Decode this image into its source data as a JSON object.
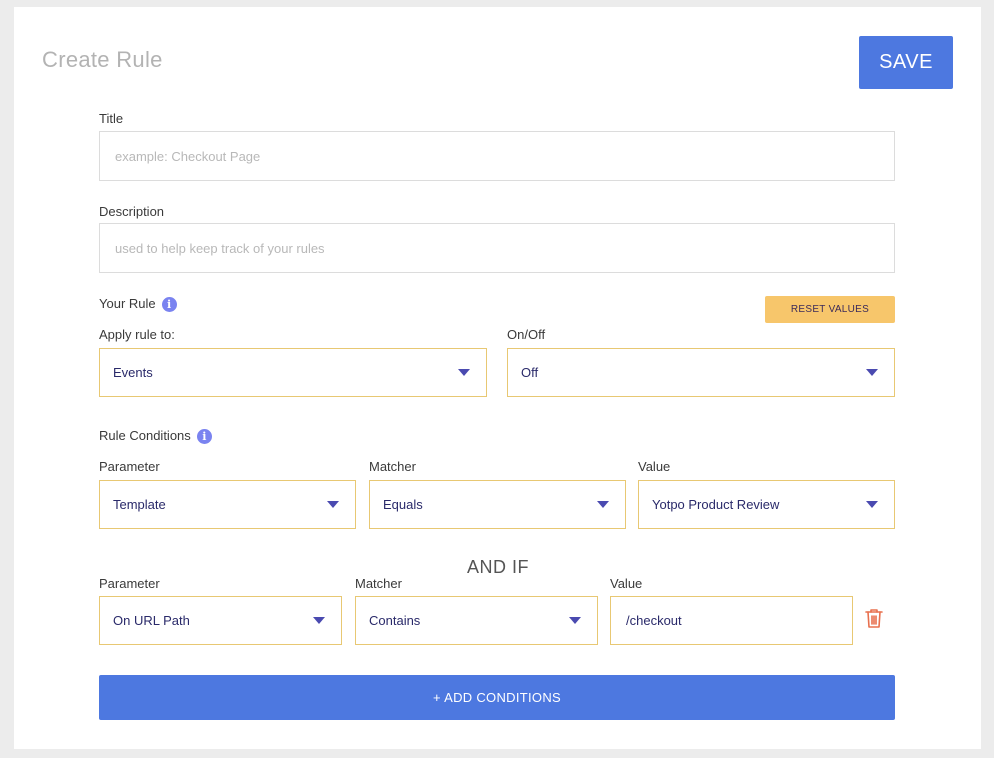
{
  "header": {
    "title": "Create Rule",
    "save_label": "SAVE"
  },
  "form": {
    "title_label": "Title",
    "title_value": "",
    "title_placeholder": "example: Checkout Page",
    "description_label": "Description",
    "description_value": "",
    "description_placeholder": "used to help keep track of your rules",
    "your_rule_label": "Your Rule",
    "reset_label": "RESET VALUES",
    "apply_rule_label": "Apply rule to:",
    "apply_rule_value": "Events",
    "onoff_label": "On/Off",
    "onoff_value": "Off"
  },
  "conditions": {
    "label": "Rule Conditions",
    "and_if_label": "AND IF",
    "rows": [
      {
        "parameter_label": "Parameter",
        "parameter_value": "Template",
        "matcher_label": "Matcher",
        "matcher_value": "Equals",
        "value_label": "Value",
        "value_value": "Yotpo Product Review"
      },
      {
        "parameter_label": "Parameter",
        "parameter_value": "On URL Path",
        "matcher_label": "Matcher",
        "matcher_value": "Contains",
        "value_label": "Value",
        "value_value": "/checkout"
      }
    ],
    "add_label": "+ ADD CONDITIONS"
  },
  "icons": {
    "info": "info-icon",
    "dropdown": "chevron-down-icon",
    "delete": "trash-icon"
  },
  "colors": {
    "primary": "#4d78e0",
    "warning": "#f7c66b",
    "select_border": "#e8c873",
    "delete": "#e8704e",
    "info": "#7a83f0"
  }
}
